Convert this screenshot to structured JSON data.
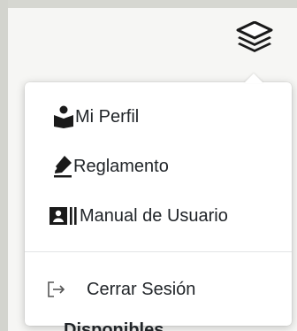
{
  "header": {
    "menu_icon": "layers-icon"
  },
  "dropdown": {
    "items": [
      {
        "label": "Mi Perfil",
        "icon": "user-reading-icon"
      },
      {
        "label": "Reglamento",
        "icon": "signature-icon"
      },
      {
        "label": "Manual de Usuario",
        "icon": "id-card-icon"
      }
    ],
    "logout": {
      "label": "Cerrar Sesión",
      "icon": "sign-out-icon"
    }
  },
  "background": {
    "partial_text": "Disponibles"
  },
  "colors": {
    "text": "#212529",
    "menu_bg": "#ffffff",
    "page_bg": "#dfe0da"
  }
}
